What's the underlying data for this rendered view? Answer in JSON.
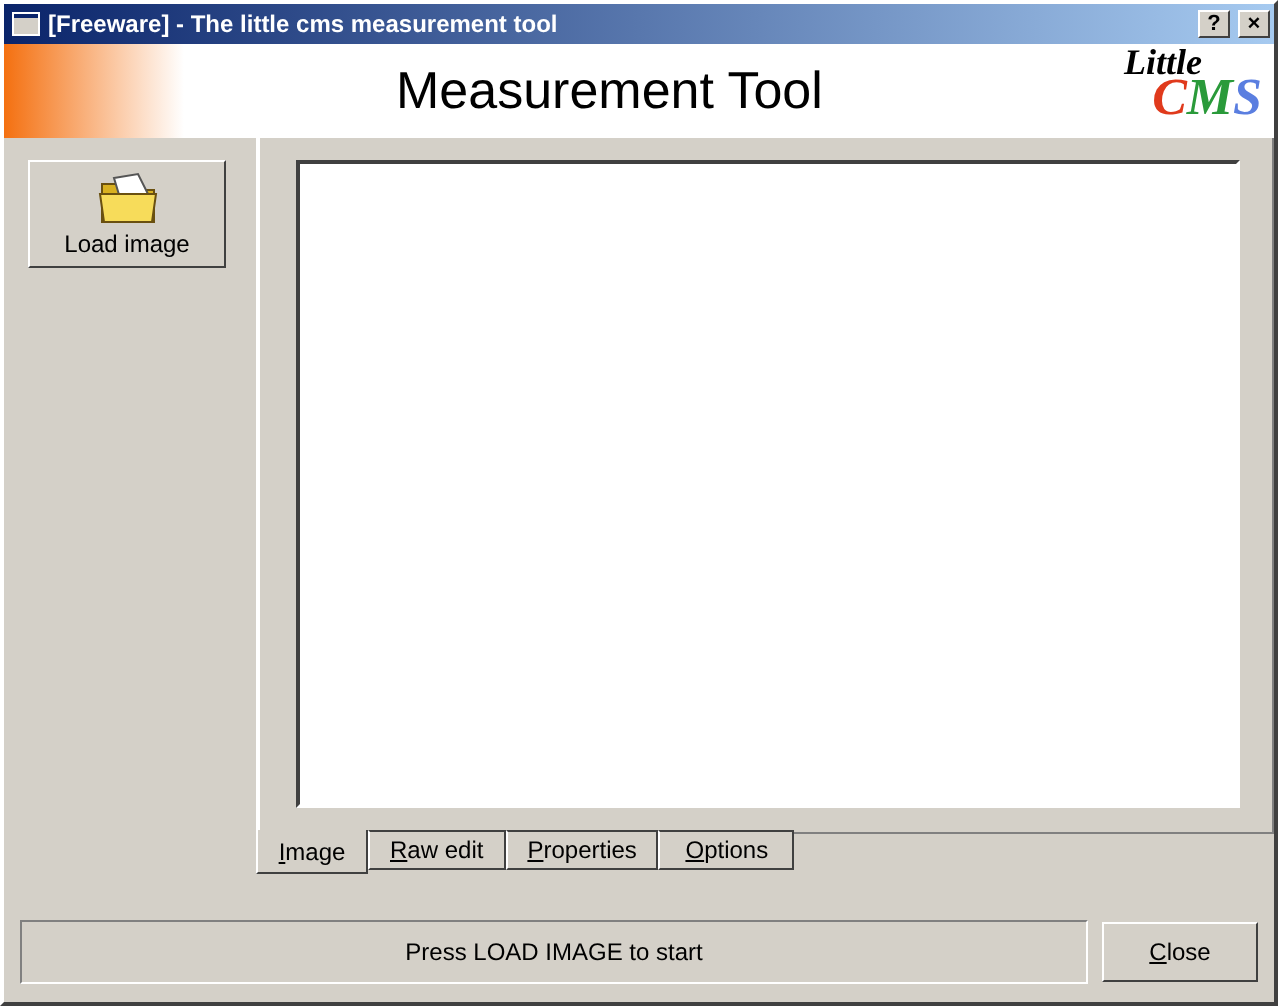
{
  "window": {
    "title": "[Freeware] - The little cms measurement tool",
    "buttons": [
      "?",
      "×"
    ]
  },
  "header": {
    "title": "Measurement Tool",
    "logo_top": "Little",
    "logo_bottom": "CMS"
  },
  "toolbar": {
    "load_button": "Load image"
  },
  "tabs": [
    {
      "label": "Image",
      "selected": true
    },
    {
      "label": "Raw edit",
      "selected": false
    },
    {
      "label": "Properties",
      "selected": false
    },
    {
      "label": "Options",
      "selected": false
    }
  ],
  "status_bar": {
    "message": "Press LOAD IMAGE to start",
    "close_button": "Close"
  }
}
